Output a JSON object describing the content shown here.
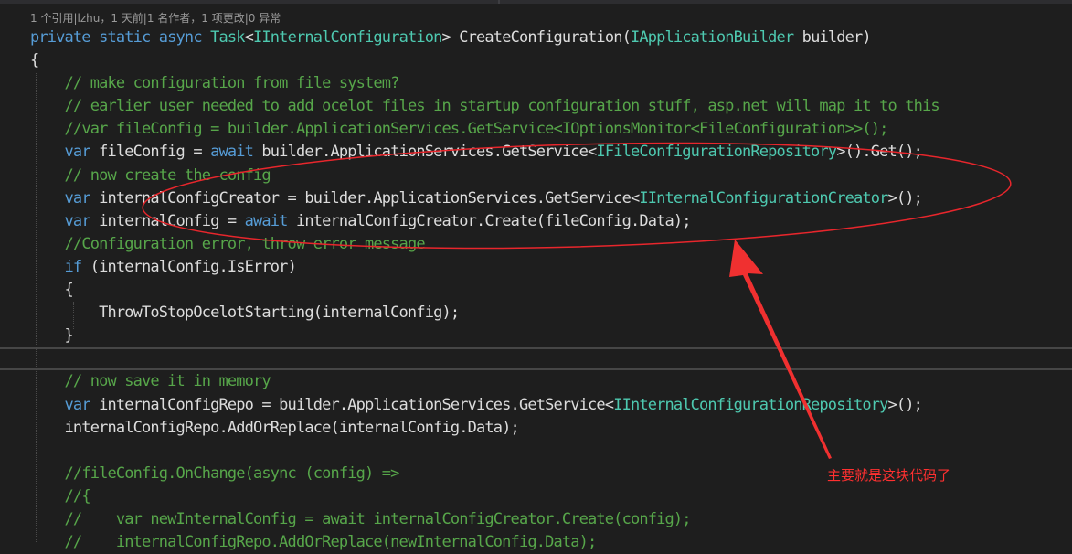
{
  "codelens": "1 个引用|lzhu，1 天前|1 名作者，1 项更改|0 异常",
  "annotation": "主要就是这块代码了",
  "colors": {
    "background": "#1e1e1e",
    "keyword": "#569cd6",
    "comment": "#57a64a",
    "type": "#4ec9b0",
    "plain": "#dcdcdc",
    "annotation": "#ff3030"
  },
  "lines": [
    {
      "name": "code-line-signature",
      "tokens": [
        {
          "c": "kw",
          "t": "private static async "
        },
        {
          "c": "ty",
          "t": "Task"
        },
        {
          "c": "pl",
          "t": "<"
        },
        {
          "c": "ty",
          "t": "IInternalConfiguration"
        },
        {
          "c": "pl",
          "t": "> CreateConfiguration("
        },
        {
          "c": "ty",
          "t": "IApplicationBuilder"
        },
        {
          "c": "pl",
          "t": " builder)"
        }
      ]
    },
    {
      "name": "code-line-open-brace",
      "tokens": [
        {
          "c": "pl",
          "t": "{"
        }
      ]
    },
    {
      "name": "code-line-comment-make-config",
      "tokens": [
        {
          "c": "pl",
          "t": "    "
        },
        {
          "c": "cm",
          "t": "// make configuration from file system?"
        }
      ]
    },
    {
      "name": "code-line-comment-earlier-user",
      "tokens": [
        {
          "c": "pl",
          "t": "    "
        },
        {
          "c": "cm",
          "t": "// earlier user needed to add ocelot files in startup configuration stuff, asp.net will map it to this"
        }
      ]
    },
    {
      "name": "code-line-comment-var-fileconfig",
      "tokens": [
        {
          "c": "pl",
          "t": "    "
        },
        {
          "c": "cm",
          "t": "//var fileConfig = builder.ApplicationServices.GetService<IOptionsMonitor<FileConfiguration>>();"
        }
      ]
    },
    {
      "name": "code-line-fileconfig",
      "tokens": [
        {
          "c": "pl",
          "t": "    "
        },
        {
          "c": "kw",
          "t": "var"
        },
        {
          "c": "pl",
          "t": " fileConfig = "
        },
        {
          "c": "kw",
          "t": "await"
        },
        {
          "c": "pl",
          "t": " builder.ApplicationServices.GetService<"
        },
        {
          "c": "ty",
          "t": "IFileConfigurationRepository"
        },
        {
          "c": "pl",
          "t": ">().Get();"
        }
      ]
    },
    {
      "name": "code-line-comment-now-create",
      "tokens": [
        {
          "c": "pl",
          "t": "    "
        },
        {
          "c": "cm",
          "t": "// now create the config"
        }
      ]
    },
    {
      "name": "code-line-config-creator",
      "tokens": [
        {
          "c": "pl",
          "t": "    "
        },
        {
          "c": "kw",
          "t": "var"
        },
        {
          "c": "pl",
          "t": " internalConfigCreator = builder.ApplicationServices.GetService<"
        },
        {
          "c": "ty",
          "t": "IInternalConfigurationCreator"
        },
        {
          "c": "pl",
          "t": ">();"
        }
      ]
    },
    {
      "name": "code-line-internal-config",
      "tokens": [
        {
          "c": "pl",
          "t": "    "
        },
        {
          "c": "kw",
          "t": "var"
        },
        {
          "c": "pl",
          "t": " internalConfig = "
        },
        {
          "c": "kw",
          "t": "await"
        },
        {
          "c": "pl",
          "t": " internalConfigCreator.Create(fileConfig.Data);"
        }
      ]
    },
    {
      "name": "code-line-comment-config-error",
      "tokens": [
        {
          "c": "pl",
          "t": "    "
        },
        {
          "c": "cm",
          "t": "//Configuration error, throw error message"
        }
      ]
    },
    {
      "name": "code-line-if-is-error",
      "tokens": [
        {
          "c": "pl",
          "t": "    "
        },
        {
          "c": "kw",
          "t": "if"
        },
        {
          "c": "pl",
          "t": " (internalConfig.IsError)"
        }
      ]
    },
    {
      "name": "code-line-if-open-brace",
      "tokens": [
        {
          "c": "pl",
          "t": "    {"
        }
      ]
    },
    {
      "name": "code-line-throw",
      "tokens": [
        {
          "c": "pl",
          "t": "        ThrowToStopOcelotStarting(internalConfig);"
        }
      ]
    },
    {
      "name": "code-line-if-close-brace",
      "tokens": [
        {
          "c": "pl",
          "t": "    }"
        }
      ]
    },
    {
      "name": "code-line-blank-current",
      "tokens": []
    },
    {
      "name": "code-line-comment-now-save",
      "tokens": [
        {
          "c": "pl",
          "t": "    "
        },
        {
          "c": "cm",
          "t": "// now save it in memory"
        }
      ]
    },
    {
      "name": "code-line-config-repo",
      "tokens": [
        {
          "c": "pl",
          "t": "    "
        },
        {
          "c": "kw",
          "t": "var"
        },
        {
          "c": "pl",
          "t": " internalConfigRepo = builder.ApplicationServices.GetService<"
        },
        {
          "c": "ty",
          "t": "IInternalConfigurationRepository"
        },
        {
          "c": "pl",
          "t": ">();"
        }
      ]
    },
    {
      "name": "code-line-add-or-replace",
      "tokens": [
        {
          "c": "pl",
          "t": "    internalConfigRepo.AddOrReplace(internalConfig.Data);"
        }
      ]
    },
    {
      "name": "code-line-blank",
      "tokens": []
    },
    {
      "name": "code-line-comment-onchange",
      "tokens": [
        {
          "c": "pl",
          "t": "    "
        },
        {
          "c": "cm",
          "t": "//fileConfig.OnChange(async (config) =>"
        }
      ]
    },
    {
      "name": "code-line-comment-open-brace",
      "tokens": [
        {
          "c": "pl",
          "t": "    "
        },
        {
          "c": "cm",
          "t": "//{"
        }
      ]
    },
    {
      "name": "code-line-comment-new-internal-config",
      "tokens": [
        {
          "c": "pl",
          "t": "    "
        },
        {
          "c": "cm",
          "t": "//    var newInternalConfig = await internalConfigCreator.Create(config);"
        }
      ]
    },
    {
      "name": "code-line-comment-add-or-replace",
      "tokens": [
        {
          "c": "pl",
          "t": "    "
        },
        {
          "c": "cm",
          "t": "//    internalConfigRepo.AddOrReplace(newInternalConfig.Data);"
        }
      ]
    }
  ]
}
